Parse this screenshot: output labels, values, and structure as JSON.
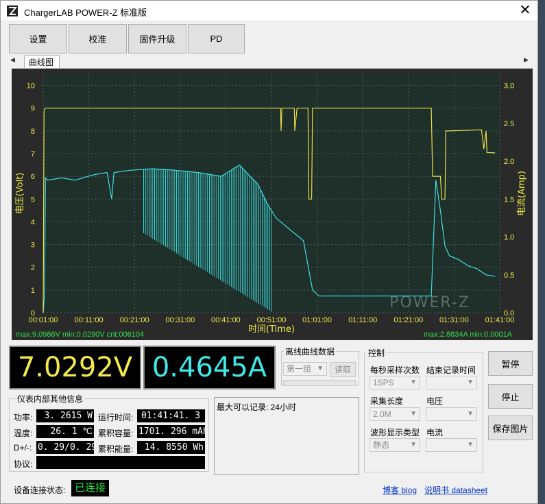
{
  "window": {
    "title": "ChargerLAB POWER-Z 标准版",
    "close_glyph": "✕"
  },
  "toolbar": {
    "buttons": [
      "设置",
      "校准",
      "固件升级",
      "PD"
    ]
  },
  "tabs": {
    "prev": "◀",
    "next": "▶",
    "active": "曲线图"
  },
  "chart_data": {
    "type": "line",
    "xlabel": "时间(Time)",
    "ylabel_left": "电压(Volt)",
    "ylabel_right": "电流(Amp)",
    "x_ticks": [
      "00:01:00",
      "00:11:00",
      "00:21:00",
      "00:31:00",
      "00:41:00",
      "00:51:00",
      "01:01:00",
      "01:11:00",
      "01:21:00",
      "01:31:00",
      "01:41:00"
    ],
    "x_range_min": [
      1,
      101
    ],
    "y_left_ticks": [
      "0",
      "1",
      "2",
      "3",
      "4",
      "5",
      "6",
      "7",
      "8",
      "9",
      "10"
    ],
    "y_left_range": [
      0,
      10.5
    ],
    "y_right_ticks": [
      "0.0",
      "0.5",
      "1.0",
      "1.5",
      "2.0",
      "2.5",
      "3.0"
    ],
    "y_right_range": [
      0,
      3.15
    ],
    "grid": true,
    "watermark": "POWER-Z",
    "voltage_stats": "max:9.0986V min:0.0290V cnt:006104",
    "current_stats": "max:2.8834A min:0.0001A",
    "series": [
      {
        "name": "电压(Volt)",
        "axis": "left",
        "color": "#e8e04a",
        "points": [
          [
            1,
            0
          ],
          [
            1.2,
            8.9
          ],
          [
            1.5,
            9.0
          ],
          [
            15,
            9.0
          ],
          [
            30,
            9.0
          ],
          [
            45,
            9.0
          ],
          [
            52,
            9.0
          ],
          [
            53,
            9.0
          ],
          [
            53.1,
            8.0
          ],
          [
            53.3,
            9.0
          ],
          [
            56,
            9.0
          ],
          [
            56.1,
            8.0
          ],
          [
            56.6,
            9.0
          ],
          [
            59,
            9.0
          ],
          [
            59.2,
            5.0
          ],
          [
            59.8,
            5.0
          ],
          [
            60,
            9.0
          ],
          [
            61.4,
            9.0
          ],
          [
            70,
            9.0
          ],
          [
            80,
            9.0
          ],
          [
            86,
            9.0
          ],
          [
            86.3,
            6.0
          ],
          [
            88,
            6.0
          ],
          [
            88.3,
            5.0
          ],
          [
            89,
            5.0
          ],
          [
            89.2,
            8.0
          ],
          [
            90,
            8.0
          ],
          [
            97,
            8.05
          ],
          [
            97.5,
            7.2
          ],
          [
            98,
            8.0
          ],
          [
            98.2,
            7.05
          ],
          [
            100,
            7.03
          ]
        ]
      },
      {
        "name": "电流(Amp)",
        "axis": "right",
        "color": "#3fe0e0",
        "points": [
          [
            1,
            0
          ],
          [
            1.3,
            0.25
          ],
          [
            1.5,
            1.78
          ],
          [
            2,
            1.75
          ],
          [
            5,
            1.78
          ],
          [
            8,
            1.75
          ],
          [
            12,
            1.82
          ],
          [
            15,
            1.85
          ],
          [
            16,
            1.5
          ],
          [
            16.5,
            1.85
          ],
          [
            20,
            1.88
          ],
          [
            25,
            1.9
          ],
          [
            30,
            1.88
          ],
          [
            35,
            1.85
          ],
          [
            40,
            1.8
          ],
          [
            44,
            1.95
          ],
          [
            46,
            1.82
          ],
          [
            48,
            1.7
          ],
          [
            50,
            1.45
          ],
          [
            52,
            1.25
          ],
          [
            55,
            1.1
          ],
          [
            58,
            0.95
          ],
          [
            60,
            0.3
          ],
          [
            61.4,
            0.22
          ],
          [
            75,
            0.22
          ],
          [
            86,
            0.22
          ],
          [
            87,
            1.75
          ],
          [
            88,
            1.35
          ],
          [
            89,
            0.88
          ],
          [
            90,
            0.75
          ],
          [
            92,
            0.7
          ],
          [
            94,
            0.62
          ],
          [
            96,
            0.58
          ],
          [
            98,
            0.5
          ],
          [
            100,
            0.48
          ]
        ]
      }
    ]
  },
  "readouts": {
    "voltage": "7.0292V",
    "current": "0.4645A"
  },
  "internal": {
    "group_label": "仪表内部其他信息",
    "power_label": "功率:",
    "power": "3. 2615  W",
    "runtime_label": "运行时间:",
    "runtime": "01:41:41. 3",
    "temp_label": "温度:",
    "temp": "26. 1  ℃",
    "capacity_label": "累积容量:",
    "capacity": "1701. 296 mAh",
    "dpm_label": "D+/-:",
    "dpm": "0. 29/0. 29V",
    "energy_label": "累积能量:",
    "energy": "14. 8550  Wh",
    "protocol_label": "协议:",
    "protocol": ""
  },
  "offline": {
    "group_label": "离线曲线数据",
    "group_select": "第一组",
    "read_button": "读取",
    "max_record": "最大可以记录: 24小时"
  },
  "control": {
    "group_label": "控制",
    "sample_label": "每秒采样次数",
    "sample_value": "1SPS",
    "end_label": "结束记录时间",
    "end_value": "",
    "length_label": "采集长度",
    "length_value": "2.0M",
    "voltage_label": "电压",
    "voltage_value": "",
    "wave_label": "波形显示类型",
    "wave_value": "静态",
    "current_label": "电流",
    "current_value": ""
  },
  "actions": {
    "pause": "暂停",
    "stop": "停止",
    "save": "保存图片"
  },
  "status": {
    "label": "设备连接状态:",
    "value": "已连接",
    "blog_link": "博客 blog",
    "datasheet_link": "说明书 datasheet"
  },
  "colors": {
    "voltage": "#e8e04a",
    "current": "#3fe0e0",
    "lcd_voltage": "#f4ea4c",
    "lcd_current": "#3fe8e8",
    "status_ok": "#27e03a",
    "plot_bg": "#1f2f2a"
  }
}
